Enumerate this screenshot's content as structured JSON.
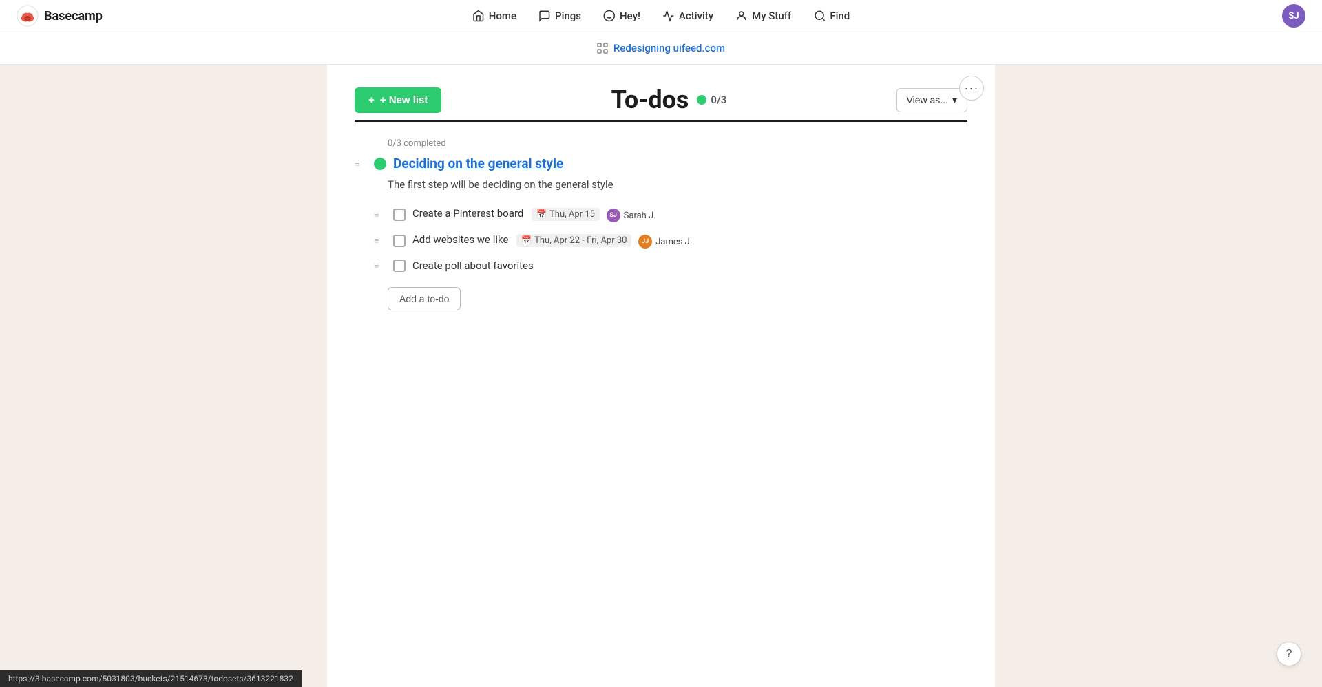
{
  "app": {
    "name": "Basecamp",
    "logo_initials": "B"
  },
  "nav": {
    "home_label": "Home",
    "pings_label": "Pings",
    "hey_label": "Hey!",
    "activity_label": "Activity",
    "my_stuff_label": "My Stuff",
    "find_label": "Find",
    "user_initials": "SJ",
    "user_avatar_color": "#7c5cbf"
  },
  "project_bar": {
    "icon": "grid-icon",
    "project_name": "Redesigning uifeed.com",
    "project_url": "https://3.basecamp.com/5031803/buckets/21514673/todosets/3613221832"
  },
  "page": {
    "title": "To-dos",
    "options_label": "···",
    "new_list_label": "+ New list",
    "view_as_label": "View as...",
    "progress_count": "0/3",
    "progress_color": "#2ecc71"
  },
  "todo_lists": [
    {
      "id": "deciding-general-style",
      "title": "Deciding on the general style",
      "title_url": "#",
      "completed_label": "0/3 completed",
      "description": "The first step will be deciding on the general style",
      "dot_color": "#2ecc71",
      "items": [
        {
          "id": "item-1",
          "text": "Create a Pinterest board",
          "due": "Thu, Apr 15",
          "due_range": false,
          "assignee_name": "Sarah J.",
          "assignee_initials": "SJ",
          "assignee_color": "#9b59b6"
        },
        {
          "id": "item-2",
          "text": "Add websites we like",
          "due": "Thu, Apr 22 - Fri, Apr 30",
          "due_range": true,
          "assignee_name": "James J.",
          "assignee_initials": "JJ",
          "assignee_color": "#e67e22"
        },
        {
          "id": "item-3",
          "text": "Create poll about favorites",
          "due": null,
          "assignee_name": null,
          "assignee_initials": null
        }
      ],
      "add_todo_label": "Add a to-do"
    }
  ],
  "bottom_bar": {
    "url": "https://3.basecamp.com/5031803/buckets/21514673/todosets/3613221832"
  },
  "help_button": {
    "label": "?"
  }
}
